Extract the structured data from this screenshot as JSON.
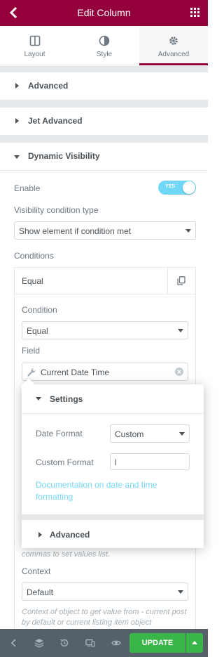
{
  "header": {
    "title": "Edit Column"
  },
  "tabs": [
    {
      "label": "Layout",
      "icon": "layout-icon"
    },
    {
      "label": "Style",
      "icon": "half-circle-icon"
    },
    {
      "label": "Advanced",
      "icon": "gear-icon",
      "active": true
    }
  ],
  "sections": {
    "advanced": "Advanced",
    "jet_advanced": "Jet Advanced",
    "dynamic_visibility": "Dynamic Visibility"
  },
  "visibility": {
    "enable_label": "Enable",
    "toggle_text": "YES",
    "condition_type_label": "Visibility condition type",
    "condition_type_value": "Show element if condition met",
    "conditions_label": "Conditions"
  },
  "condition_item": {
    "title": "Equal",
    "condition_label": "Condition",
    "condition_value": "Equal",
    "field_label": "Field",
    "field_value": "Current Date Time"
  },
  "popover": {
    "settings_label": "Settings",
    "date_format_label": "Date Format",
    "date_format_value": "Custom",
    "custom_format_label": "Custom Format",
    "custom_format_value": "l",
    "doc_link": "Documentation on date and time formatting",
    "advanced_label": "Advanced"
  },
  "values_note": "commas to set values list.",
  "context": {
    "label": "Context",
    "value": "Default",
    "note": "Context of object to get value from - current post by default or current listing item object"
  },
  "footer": {
    "update_label": "UPDATE"
  },
  "colors": {
    "brand": "#93003c",
    "toggle": "#71d7f7",
    "update": "#39b54a",
    "footer": "#556068"
  }
}
